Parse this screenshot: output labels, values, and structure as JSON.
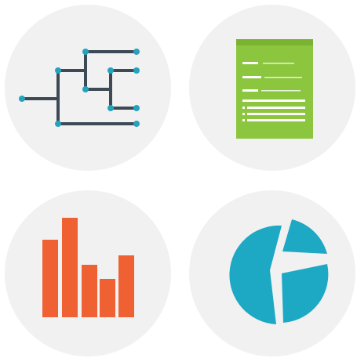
{
  "icons": [
    {
      "name": "tree-diagram-icon",
      "line_color": "#3d4a55",
      "node_color": "#25a3bd"
    },
    {
      "name": "document-icon",
      "color": "#8cc63f",
      "line_color": "#ffffff"
    },
    {
      "name": "bar-chart-icon",
      "color": "#ef6132",
      "bars": [
        0.62,
        0.78,
        0.41,
        0.31,
        0.48
      ]
    },
    {
      "name": "pie-chart-icon",
      "color": "#1da8c4"
    }
  ],
  "background_color": "#f1f1f1"
}
